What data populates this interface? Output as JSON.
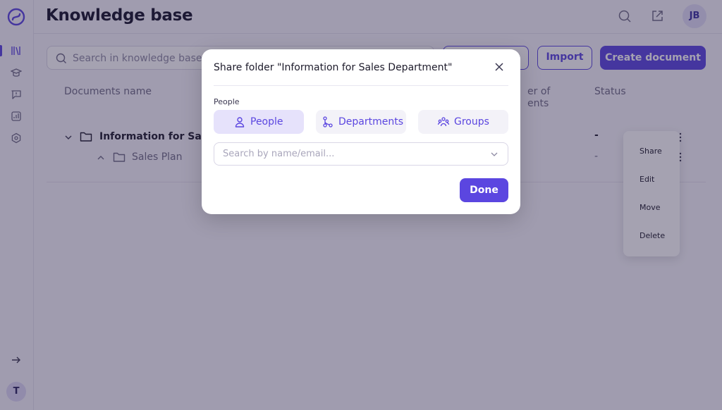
{
  "header": {
    "title": "Knowledge base",
    "avatar_initials": "JB"
  },
  "sidebar": {
    "user_initial": "T",
    "items": [
      {
        "icon": "library-icon"
      },
      {
        "icon": "graduation-cap-icon"
      },
      {
        "icon": "chat-alert-icon"
      },
      {
        "icon": "chart-icon"
      },
      {
        "icon": "settings-icon"
      }
    ]
  },
  "toolbar": {
    "search_placeholder": "Search in knowledge base",
    "import_label": "Import",
    "create_label": "Create document"
  },
  "table": {
    "columns": {
      "name": "Documents name",
      "count_line1": "er of",
      "count_line2": "ents",
      "status": "Status"
    },
    "rows": [
      {
        "name": "Information for Sales D",
        "status": "-"
      },
      {
        "name": "Sales Plan",
        "status": "-"
      }
    ]
  },
  "context_menu": {
    "items": [
      "Share",
      "Edit",
      "Move",
      "Delete"
    ]
  },
  "modal": {
    "title": "Share folder \"Information for Sales Department\"",
    "section_label": "People",
    "tabs": [
      {
        "label": "People",
        "icon": "person-icon",
        "active": true
      },
      {
        "label": "Departments",
        "icon": "hierarchy-icon",
        "active": false
      },
      {
        "label": "Groups",
        "icon": "group-icon",
        "active": false
      }
    ],
    "search_placeholder": "Search by name/email...",
    "done_label": "Done"
  },
  "colors": {
    "accent": "#5b46e0",
    "overlay": "#28224699"
  }
}
